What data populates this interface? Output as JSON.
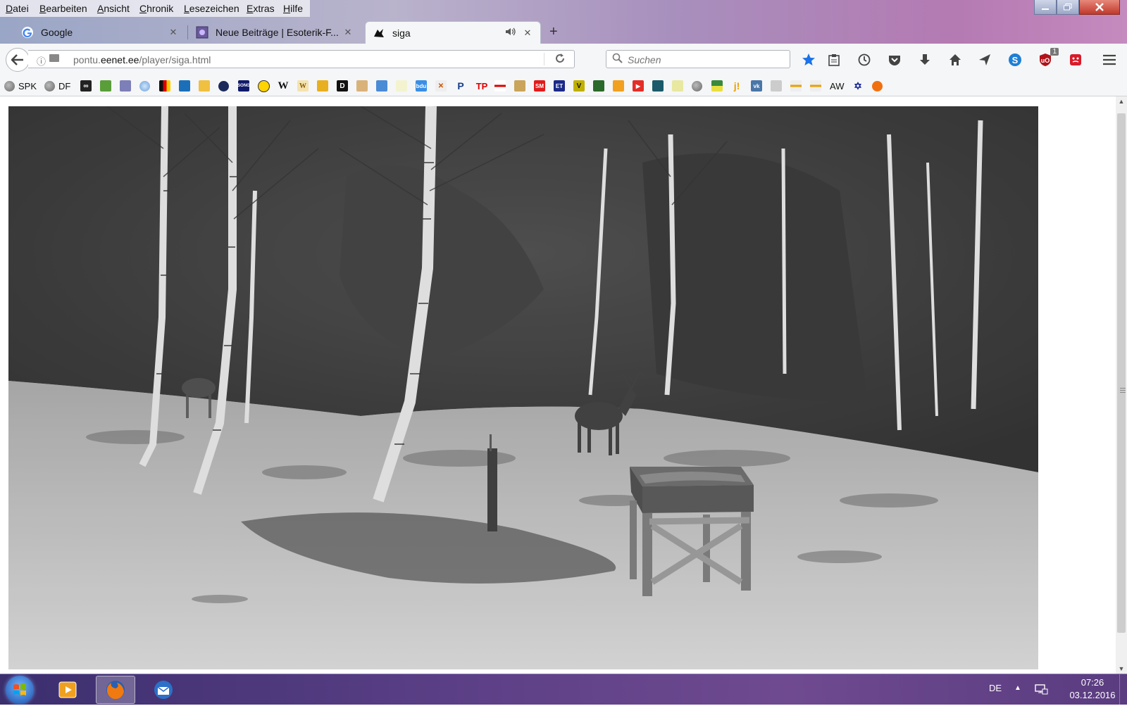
{
  "menubar": {
    "items": [
      "Datei",
      "Bearbeiten",
      "Ansicht",
      "Chronik",
      "Lesezeichen",
      "Extras",
      "Hilfe"
    ]
  },
  "tabs": [
    {
      "title": "Google",
      "favicon": "google-g-icon",
      "active": false
    },
    {
      "title": "Neue Beiträge | Esoterik-F...",
      "favicon": "forum-favicon",
      "active": false
    },
    {
      "title": "siga",
      "favicon": "player-favicon",
      "active": true,
      "audio": true
    }
  ],
  "navbar": {
    "url_prefix": "pontu.",
    "url_domain": "eenet.ee",
    "url_path": "/player/siga.html",
    "search_placeholder": "Suchen",
    "addon_badge": "1"
  },
  "bookmarks": {
    "items": [
      {
        "label": "SPK",
        "icon": "globe-icon"
      },
      {
        "label": "DF",
        "icon": "globe-icon"
      },
      {
        "label": "AW",
        "icon": "aw-icon"
      }
    ]
  },
  "taskbar": {
    "language": "DE",
    "time": "07:26",
    "date": "03.12.2016"
  },
  "colors": {
    "accent_blue": "#1a73e8",
    "close_red": "#c0392b",
    "taskbar_purple": "#5b3f86"
  }
}
